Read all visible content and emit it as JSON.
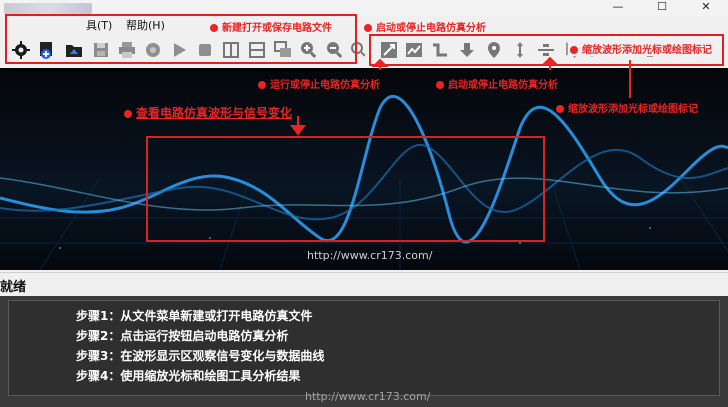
{
  "menu": {
    "tool_label": "具(T)",
    "help_label": "帮助(H)"
  },
  "window": {
    "minimize": "—",
    "maximize": "☐",
    "close": "✕"
  },
  "toolbar": {
    "buttons": [
      {
        "icon": "settings-icon"
      },
      {
        "icon": "new-file-icon"
      },
      {
        "icon": "open-file-icon"
      },
      {
        "icon": "save-icon"
      },
      {
        "icon": "print-icon"
      },
      {
        "icon": "gear-icon"
      },
      {
        "icon": "play-icon"
      },
      {
        "icon": "stop-icon"
      },
      {
        "icon": "split-vertical-icon"
      },
      {
        "icon": "split-horizontal-icon"
      },
      {
        "icon": "copy-window-icon"
      },
      {
        "icon": "zoom-in-icon"
      },
      {
        "icon": "zoom-out-icon"
      },
      {
        "icon": "zoom-fit-icon"
      },
      {
        "icon": "zoom-area-icon"
      },
      {
        "icon": "chart-icon"
      },
      {
        "icon": "step-signal-icon"
      },
      {
        "icon": "arrow-down-icon"
      },
      {
        "icon": "marker-icon"
      },
      {
        "icon": "cursor-vertical-icon"
      },
      {
        "icon": "divide-icon"
      },
      {
        "icon": "cursor-icon"
      },
      {
        "icon": "draw-icon"
      },
      {
        "icon": "ruler-icon"
      },
      {
        "icon": "text-icon"
      },
      {
        "icon": "measure-icon"
      }
    ]
  },
  "annotations": {
    "file_ops": "新建打开或保存电路文件",
    "start_stop_top": "启动或停止电路仿真分析",
    "run_stop": "运行或停止电路仿真分析",
    "start_stop_mid": "启动或停止电路仿真分析",
    "zoom_cursor_top": "缩放波形添加光标或绘图标记",
    "zoom_cursor_mid": "缩放波形添加光标或绘图标记",
    "view_waveform": "查看电路仿真波形与信号变化"
  },
  "canvas": {
    "url": "http://www.cr173.com/"
  },
  "status": {
    "text": "就绪"
  },
  "steps": [
    "步骤1：从文件菜单新建或打开电路仿真文件",
    "步骤2：点击运行按钮启动电路仿真分析",
    "步骤3：在波形显示区观察信号变化与数据曲线",
    "步骤4：使用缩放光标和绘图工具分析结果"
  ],
  "footer": {
    "url": "http://www.cr173.com/"
  },
  "colors": {
    "accent_red": "#e02020",
    "wave_blue": "#1e8fe0",
    "canvas_bg": "#06070b"
  }
}
